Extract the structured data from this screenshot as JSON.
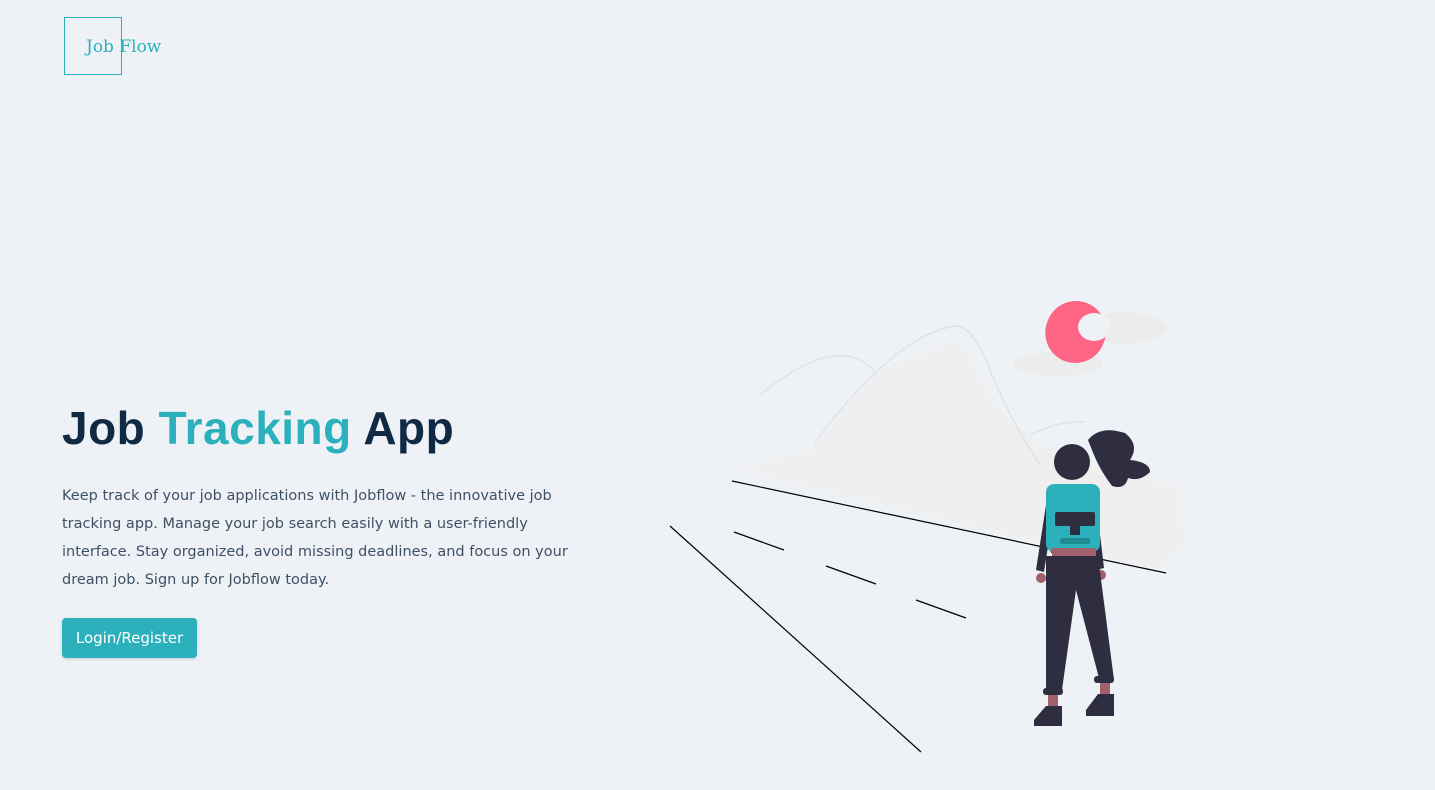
{
  "brand": {
    "logo_text": "Job Flow",
    "accent_color": "#2cb1bc"
  },
  "hero": {
    "title_part1": "Job ",
    "title_accent": "Tracking",
    "title_part2": " App",
    "description": "Keep track of your job applications with Jobflow - the innovative job tracking app. Manage your job search easily with a user-friendly interface. Stay organized, avoid missing deadlines, and focus on your dream job. Sign up for Jobflow today.",
    "cta_label": "Login/Register"
  },
  "illustration": {
    "icon": "hiker-landscape-illustration",
    "sun_color": "#ff6584",
    "figure_color": "#2f2e41",
    "backpack_color": "#2cb1bc"
  }
}
